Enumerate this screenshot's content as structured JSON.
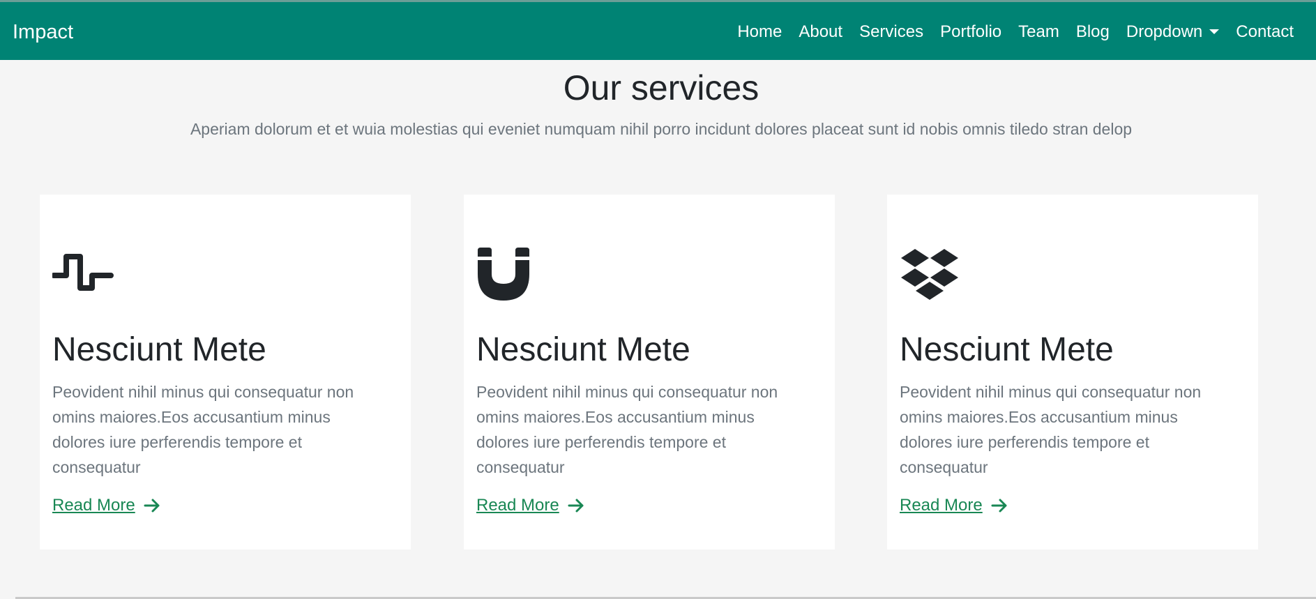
{
  "header": {
    "brand": "Impact",
    "nav": [
      {
        "label": "Home",
        "icon": null
      },
      {
        "label": "About",
        "icon": null
      },
      {
        "label": "Services",
        "icon": null
      },
      {
        "label": "Portfolio",
        "icon": null
      },
      {
        "label": "Team",
        "icon": null
      },
      {
        "label": "Blog",
        "icon": null
      },
      {
        "label": "Dropdown",
        "icon": "caret-down-icon"
      },
      {
        "label": "Contact",
        "icon": null
      }
    ],
    "bg_color": "#008374"
  },
  "services": {
    "title": "Our services",
    "subtitle": "Aperiam dolorum et et wuia molestias qui eveniet numquam nihil porro incidunt dolores placeat sunt id nobis omnis tiledo stran delop",
    "cards": [
      {
        "icon": "activity-icon",
        "title": "Nesciunt Mete",
        "text": "Peovident nihil minus qui consequatur non omins maiores.Eos accusantium minus dolores iure perferendis tempore et consequatur",
        "link": "Read More"
      },
      {
        "icon": "magnet-icon",
        "title": "Nesciunt Mete",
        "text": "Peovident nihil minus qui consequatur non omins maiores.Eos accusantium minus dolores iure perferendis tempore et consequatur",
        "link": "Read More"
      },
      {
        "icon": "dropbox-icon",
        "title": "Nesciunt Mete",
        "text": "Peovident nihil minus qui consequatur non omins maiores.Eos accusantium minus dolores iure perferendis tempore et consequatur",
        "link": "Read More"
      }
    ]
  },
  "colors": {
    "accent": "#008374",
    "link": "#198754",
    "muted_text": "#6c757d",
    "page_bg": "#f5f5f5"
  }
}
